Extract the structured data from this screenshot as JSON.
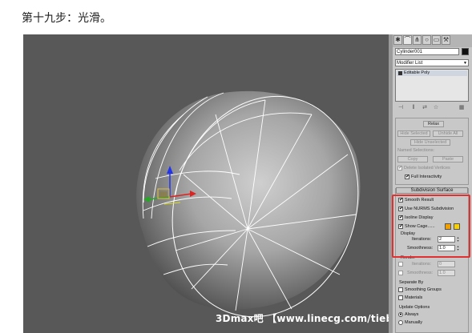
{
  "caption": "第十九步：光滑。",
  "watermark": "3Dmax吧 【www.linecg.com/tieba/1771】",
  "panel": {
    "object_name": "Cylinder001",
    "modifier_list": "Modifier List",
    "stack_item": "Editable Poly",
    "relax_label": "Relax",
    "hide_selected": "Hide Selected",
    "unhide_all": "Unhide All",
    "hide_unselected": "Hide Unselected",
    "named_selections": "Named Selections:",
    "copy": "Copy",
    "paste": "Paste",
    "delete_isolated": "Delete Isolated Vertices",
    "full_interactivity": "Full Interactivity",
    "subdivision_surface": "Subdivision Surface",
    "smooth_result": "Smooth Result",
    "use_nurms": "Use NURMS Subdivision",
    "isoline_display": "Isoline Display",
    "show_cage": "Show Cage......",
    "display_group": "Display",
    "iterations_label": "Iterations:",
    "iterations_value": "2",
    "smoothness_label": "Smoothness:",
    "smoothness_value": "1.0",
    "render_group": "Render",
    "render_iterations_value": "0",
    "render_smoothness_value": "1.0",
    "separate_by": "Separate By",
    "smoothing_groups": "Smoothing Groups",
    "materials": "Materials",
    "update_options": "Update Options",
    "always": "Always",
    "manually": "Manually",
    "check_mark": "✔",
    "cage_color_1": "#f0a000",
    "cage_color_2": "#f8d000"
  }
}
